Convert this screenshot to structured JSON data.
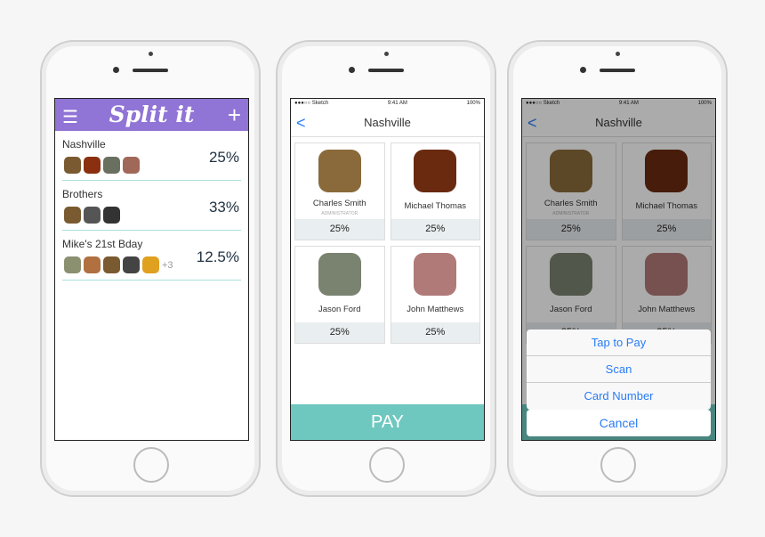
{
  "app": {
    "logo": "Split it",
    "menu_icon": "hamburger-icon",
    "add_icon": "plus-icon"
  },
  "groups": [
    {
      "name": "Nashville",
      "percent": "25%",
      "avatars": [
        "#7a5a30",
        "#8a3010",
        "#6a7060",
        "#a06858"
      ],
      "more": ""
    },
    {
      "name": "Brothers",
      "percent": "33%",
      "avatars": [
        "#7a5a30",
        "#555",
        "#333"
      ],
      "more": ""
    },
    {
      "name": "Mike's 21st Bday",
      "percent": "12.5%",
      "avatars": [
        "#8a9070",
        "#b07040",
        "#7a5a30",
        "#444",
        "#e0a020"
      ],
      "more": "+3"
    }
  ],
  "status": {
    "carrier": "●●●○○ Sketch",
    "time": "9:41 AM",
    "battery": "100%"
  },
  "detail": {
    "title": "Nashville",
    "back": "<",
    "pay": "PAY",
    "members": [
      {
        "name": "Charles Smith",
        "role": "ADMINISTRATOR",
        "percent": "25%",
        "color": "#8a6a3a"
      },
      {
        "name": "Michael Thomas",
        "role": "",
        "percent": "25%",
        "color": "#6a2a10"
      },
      {
        "name": "Jason Ford",
        "role": "",
        "percent": "25%",
        "color": "#7a8270"
      },
      {
        "name": "John Matthews",
        "role": "",
        "percent": "25%",
        "color": "#b07a78"
      }
    ]
  },
  "sheet": {
    "options": [
      "Tap to Pay",
      "Scan",
      "Card Number"
    ],
    "cancel": "Cancel"
  }
}
